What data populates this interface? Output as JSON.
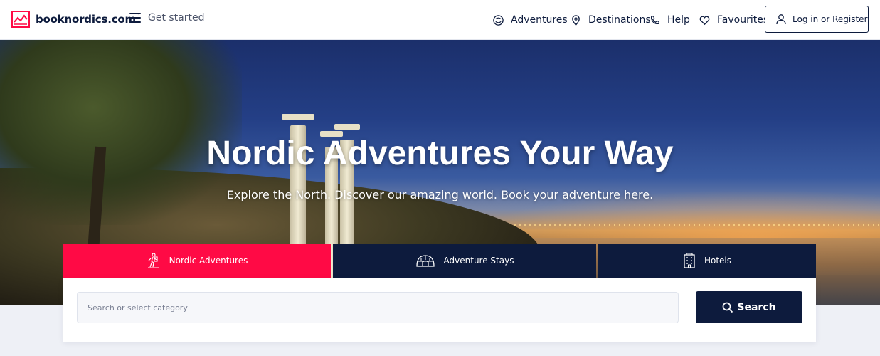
{
  "header": {
    "logo_text": "booknordics.com",
    "logo_tm": "™",
    "menu_label": "Get started",
    "nav": {
      "adventures": "Adventures",
      "destinations": "Destinations",
      "help": "Help",
      "favourites": "Favourites"
    },
    "login_label": "Log in or Register"
  },
  "hero": {
    "title": "Nordic Adventures Your Way",
    "subtitle": "Explore the North. Discover our amazing world. Book your adventure here."
  },
  "tabs": [
    {
      "label": "Nordic Adventures",
      "icon": "hiker-icon",
      "active": true
    },
    {
      "label": "Adventure Stays",
      "icon": "igloo-icon",
      "active": false
    },
    {
      "label": "Hotels",
      "icon": "hotel-icon",
      "active": false
    }
  ],
  "search": {
    "placeholder": "Search or select category",
    "value": "",
    "button_label": "Search"
  },
  "colors": {
    "brand_navy": "#0d1b3d",
    "accent_red": "#ff0a45"
  }
}
